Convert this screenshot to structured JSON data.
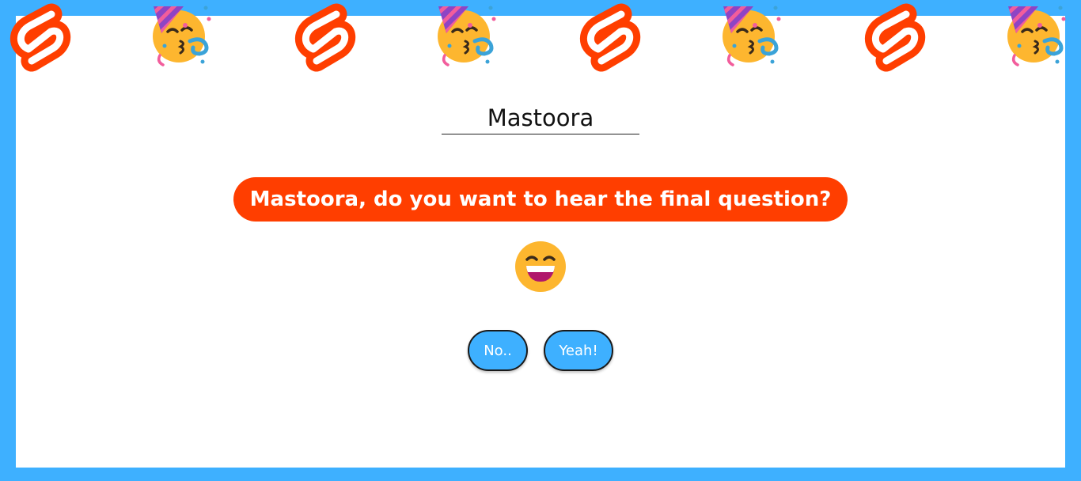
{
  "name_input": {
    "value": "Mastoora"
  },
  "question": {
    "text": "Mastoora, do you want to hear the final question?"
  },
  "buttons": {
    "no_label": "No..",
    "yes_label": "Yeah!"
  },
  "banner": {
    "icons": [
      "svelte-logo-icon",
      "partying-face-icon",
      "svelte-logo-icon",
      "partying-face-icon",
      "svelte-logo-icon",
      "partying-face-icon",
      "svelte-logo-icon",
      "partying-face-icon"
    ]
  },
  "center_icon": "grinning-face-icon",
  "colors": {
    "frame": "#3eb0ff",
    "accent": "#ff3e00",
    "button": "#3eb0ff",
    "emoji_yellow": "#fdb62f"
  }
}
